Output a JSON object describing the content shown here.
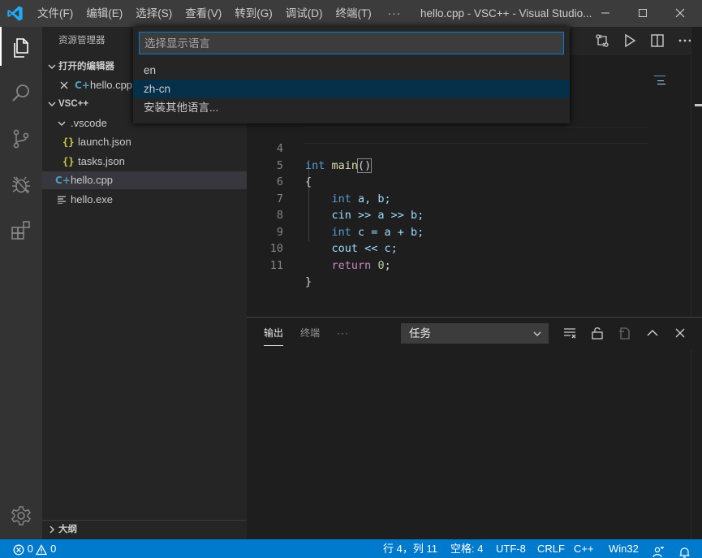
{
  "titlebar": {
    "menus": [
      "文件(F)",
      "编辑(E)",
      "选择(S)",
      "查看(V)",
      "转到(G)",
      "调试(D)",
      "终端(T)",
      "···"
    ],
    "window_title": "hello.cpp - VSC++ - Visual Studio..."
  },
  "sidebar": {
    "title": "资源管理器",
    "open_editors_header": "打开的编辑器",
    "open_editor_file": "hello.cpp",
    "project_header": "VSC++",
    "tree": [
      {
        "name": ".vscode",
        "icon": "chevron-down-icon"
      },
      {
        "name": "launch.json",
        "icon": "json-icon"
      },
      {
        "name": "tasks.json",
        "icon": "json-icon"
      },
      {
        "name": "hello.cpp",
        "icon": "cpp-icon"
      },
      {
        "name": "hello.exe",
        "icon": "file-icon"
      }
    ],
    "outline_header": "大纲"
  },
  "editor": {
    "lines": [
      {
        "num": "4"
      },
      {
        "num": "5"
      },
      {
        "num": "6"
      },
      {
        "num": "7"
      },
      {
        "num": "8"
      },
      {
        "num": "9"
      },
      {
        "num": "10"
      },
      {
        "num": "11"
      }
    ],
    "tokens": {
      "int": "int",
      "main": "main",
      "paren": "()",
      "open_brace": "{",
      "close_brace": "}",
      "decl_ab": " a, b;",
      "cin": "cin",
      "cin_rest": " >> a >> b;",
      "c_rest": " c = a + b;",
      "cout": "cout",
      "cout_rest": " << c;",
      "return": "return",
      "zero": "0",
      "semi": ";"
    }
  },
  "palette": {
    "placeholder": "选择显示语言",
    "items": [
      "en",
      "zh-cn",
      "安装其他语言..."
    ],
    "focused_index": 1
  },
  "panel": {
    "tabs": [
      "输出",
      "终端"
    ],
    "more": "···",
    "task_select": "任务"
  },
  "statusbar": {
    "errors": "0",
    "warnings": "0",
    "position": "行 4，列 11",
    "spaces": "空格: 4",
    "encoding": "UTF-8",
    "eol": "CRLF",
    "language": "C++",
    "platform": "Win32"
  },
  "colors": {
    "accent": "#007acc",
    "titlebar": "#3c3c3c",
    "activitybar": "#333333",
    "sidebar": "#252526",
    "editor": "#1e1e1e",
    "focused_item": "#062f4a"
  }
}
